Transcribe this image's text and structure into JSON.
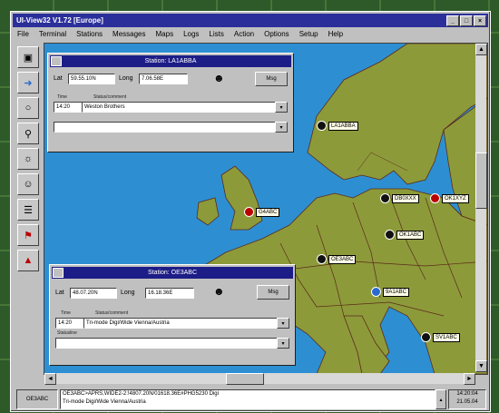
{
  "window": {
    "title": "UI-View32 V1.72 [Europe]"
  },
  "menu": [
    "File",
    "Terminal",
    "Stations",
    "Messages",
    "Maps",
    "Logs",
    "Lists",
    "Action",
    "Options",
    "Setup",
    "Help"
  ],
  "toolbar_icons": [
    "station-icon",
    "arrow-icon",
    "circle-icon",
    "beacon-icon",
    "wx-icon",
    "person-icon",
    "list-icon",
    "flag-icon",
    "triangle-icon"
  ],
  "map": {
    "colors": {
      "sea": "#2d8fd2",
      "land": "#8d9a3a",
      "border": "#5a2a1a"
    },
    "cities": [
      {
        "label": "LA1ABBA"
      },
      {
        "label": "DB0XXX"
      },
      {
        "label": "OK1XYZ"
      },
      {
        "label": "OK1ABC"
      },
      {
        "label": "G4ABC"
      },
      {
        "label": "OE3ABC"
      },
      {
        "label": "9A1ABC"
      },
      {
        "label": "SV1ABC"
      }
    ]
  },
  "dialog1": {
    "title": "Station: LA1ABBA",
    "lat_label": "Lat",
    "lat": "59.55.10N",
    "long_label": "Long",
    "long": "7.06.58E",
    "button": "Msg",
    "col_time": "Time",
    "col_status": "Status/comment",
    "time": "14:20",
    "status": "Weston Brothers",
    "extra": ""
  },
  "dialog2": {
    "title": "Station: OE3ABC",
    "lat_label": "Lat",
    "lat": "48.07.20N",
    "long_label": "Long",
    "long": "16.18.36E",
    "button": "Msg",
    "col_time": "Time",
    "col_status": "Status/comment",
    "time": "14:20",
    "status": "Tri-mode Digi/Wide Vienna/Austria",
    "sub_label": "Statusline",
    "extra": ""
  },
  "status": {
    "callsign": "OE3ABC",
    "line1": "OE3ABC>APRS,WIDE2-2:!4807.20N/01618.36E#PHG5230 Digi",
    "line2": "Tri-mode Digi/Wide Vienna/Austria",
    "time1": "14:20:04",
    "time2": "21.05.04"
  }
}
